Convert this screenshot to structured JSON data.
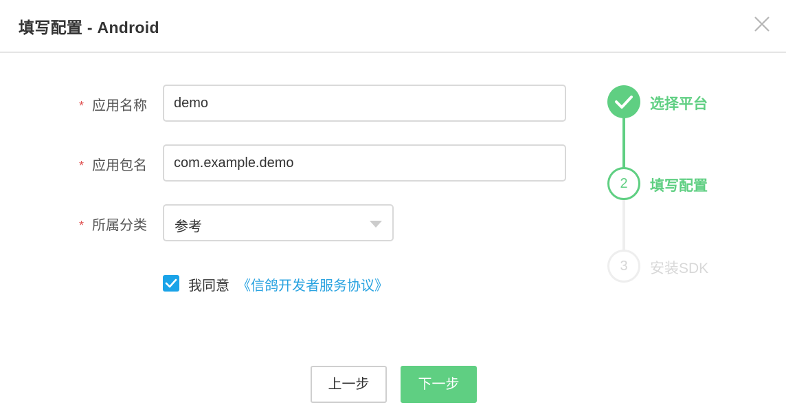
{
  "dialog": {
    "title": "填写配置 - Android",
    "close_icon": "close-icon"
  },
  "form": {
    "required_mark": "*",
    "app_name": {
      "label": "应用名称",
      "value": "demo"
    },
    "package_name": {
      "label": "应用包名",
      "value": "com.example.demo"
    },
    "category": {
      "label": "所属分类",
      "selected": "参考"
    },
    "agreement": {
      "checked": true,
      "text": "我同意",
      "link": "《信鸽开发者服务协议》"
    }
  },
  "steps": [
    {
      "label": "选择平台",
      "state": "done",
      "icon": "check-icon"
    },
    {
      "label": "填写配置",
      "state": "active",
      "number": "2"
    },
    {
      "label": "安装SDK",
      "state": "pending",
      "number": "3"
    }
  ],
  "buttons": {
    "prev": "上一步",
    "next": "下一步"
  },
  "colors": {
    "primary_green": "#5fcf82",
    "link_blue": "#2aa3e0",
    "checkbox_blue": "#1aa3e8",
    "required_red": "#e05454",
    "pending_gray": "#e5e5e5"
  }
}
